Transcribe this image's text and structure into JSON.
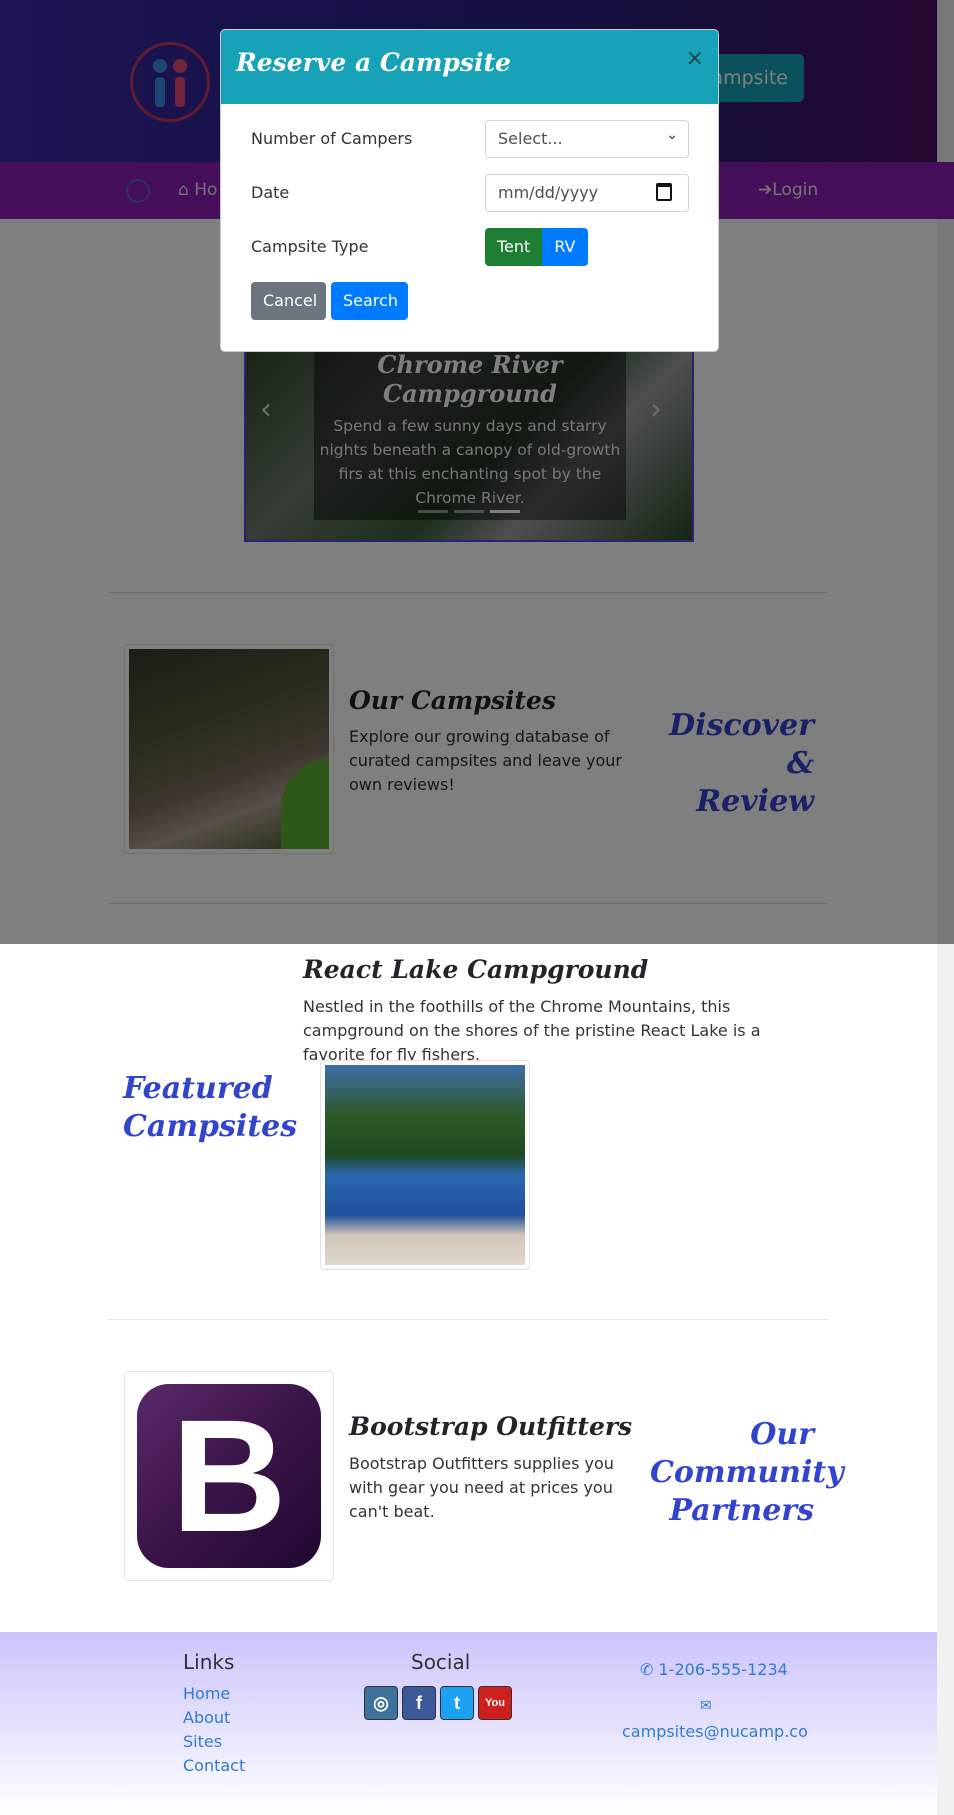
{
  "header": {
    "reserve_button": "Reserve Campsite",
    "reserve_visible": "ampsite"
  },
  "nav": {
    "home": "Home",
    "home_visible": "Ho",
    "login": "Login"
  },
  "modal": {
    "title": "Reserve a Campsite",
    "close": "×",
    "campers_label": "Number of Campers",
    "campers_value": "Select...",
    "date_label": "Date",
    "date_placeholder": "mm/dd/yyyy",
    "type_label": "Campsite Type",
    "type_tent": "Tent",
    "type_rv": "RV",
    "cancel": "Cancel",
    "search": "Search"
  },
  "carousel": {
    "title": "Chrome River Campground",
    "text": "Spend a few sunny days and starry nights beneath a canopy of old-growth firs at this enchanting spot by the Chrome River.",
    "prev": "‹",
    "next": "›",
    "active_index": 2,
    "slide_count": 3
  },
  "campsites": {
    "title": "Our Campsites",
    "text": "Explore our growing database of curated campsites and leave your own reviews!",
    "side_heading": "Discover & Review"
  },
  "featured": {
    "side_heading": "Featured Campsites",
    "title": "React Lake Campground",
    "text": "Nestled in the foothills of the Chrome Mountains, this campground on the shores of the pristine React Lake is a favorite for fly fishers."
  },
  "partners": {
    "title": "Bootstrap Outfitters",
    "text": "Bootstrap Outfitters supplies you with gear you need at prices you can't beat.",
    "side_heading": "Our Community Partners",
    "logo_letter": "B"
  },
  "footer": {
    "links_heading": "Links",
    "links": [
      "Home",
      "About",
      "Sites",
      "Contact"
    ],
    "social_heading": "Social",
    "phone": "1-206-555-1234",
    "email": "campsites@nucamp.co"
  },
  "colors": {
    "modal_header": "#17a2b8",
    "navbar": "#8a1fb5",
    "accent_heading": "#3344cc"
  }
}
